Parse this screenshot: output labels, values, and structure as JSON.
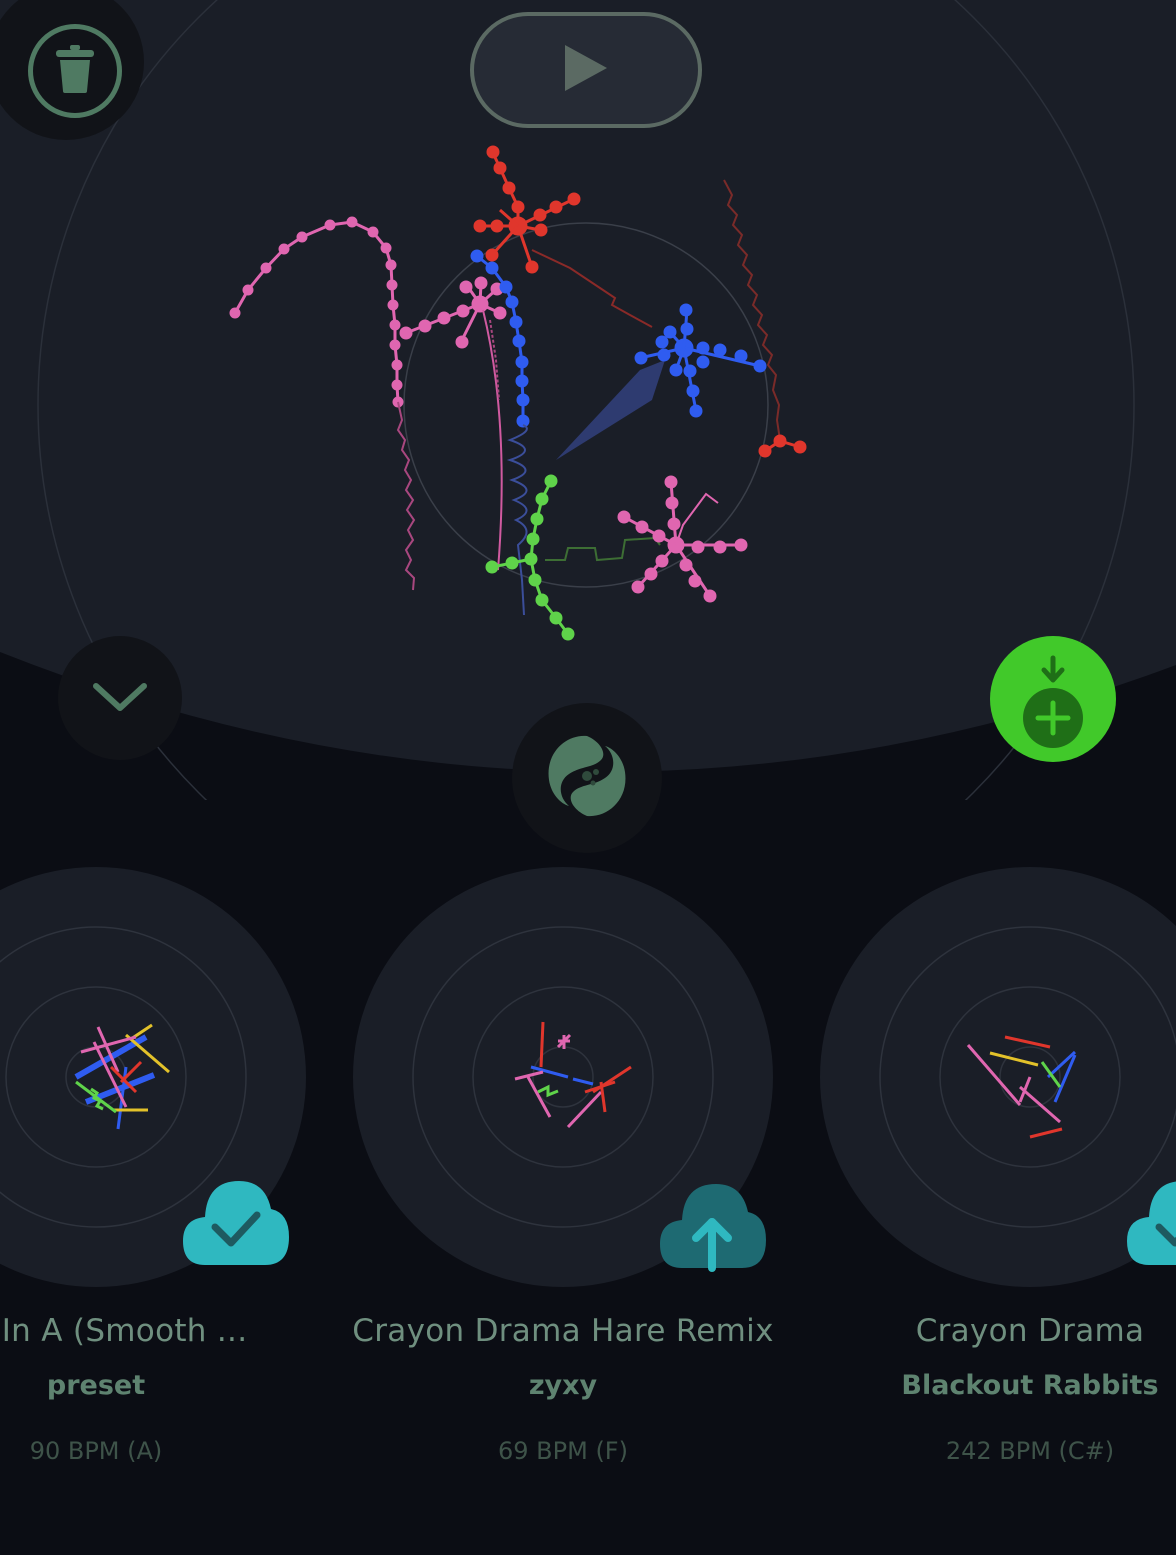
{
  "colors": {
    "background": "#0b0d14",
    "canvas": "#1a1e27",
    "accent_green": "#41c92a",
    "muted_green": "#4f7a62",
    "cloud_teal": "#2fb8c0",
    "cloud_dark_teal": "#1e6a72",
    "track_red": "#e0362c",
    "track_blue": "#2f5cf0",
    "track_pink": "#e066b0",
    "track_green": "#5fd34a"
  },
  "toolbar": {
    "delete_icon": "trash-icon",
    "play_icon": "play-icon",
    "collapse_icon": "chevron-down-icon",
    "add_icon": "download-add-icon",
    "brand_icon": "yin-yang-logo-icon"
  },
  "carousel": {
    "items": [
      {
        "title": "ms In A (Smooth ...",
        "author": "preset",
        "bpm": "90 BPM (A)",
        "cloud_status": "synced",
        "cloud_icon": "cloud-check-icon"
      },
      {
        "title": "Crayon Drama Hare Remix",
        "author": "zyxy",
        "bpm": "69 BPM (F)",
        "cloud_status": "upload",
        "cloud_icon": "cloud-upload-icon"
      },
      {
        "title": "Crayon Drama",
        "author": "Blackout Rabbits",
        "bpm": "242 BPM (C#)",
        "cloud_status": "synced",
        "cloud_icon": "cloud-check-icon"
      }
    ]
  }
}
